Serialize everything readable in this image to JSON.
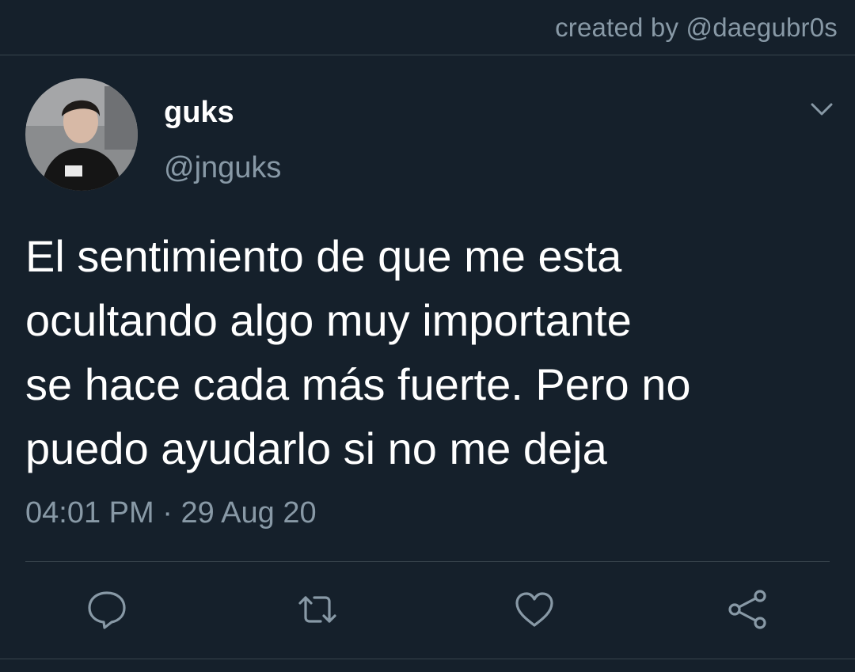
{
  "credit": "created by @daegubr0s",
  "tweet": {
    "display_name": "guks",
    "handle": "@jnguks",
    "text_lines": [
      "El sentimiento de que me esta",
      "ocultando algo muy importante",
      "se hace cada más fuerte. Pero no",
      "puedo ayudarlo si no me deja"
    ],
    "time": "04:01 PM",
    "separator": " · ",
    "date": "29 Aug 20"
  },
  "icons": {
    "caret": "chevron-down-icon",
    "reply": "reply-icon",
    "retweet": "retweet-icon",
    "like": "heart-icon",
    "share": "share-icon"
  },
  "colors": {
    "background": "#15202b",
    "text_primary": "#ffffff",
    "text_secondary": "#8899a6",
    "divider": "#38444d"
  }
}
